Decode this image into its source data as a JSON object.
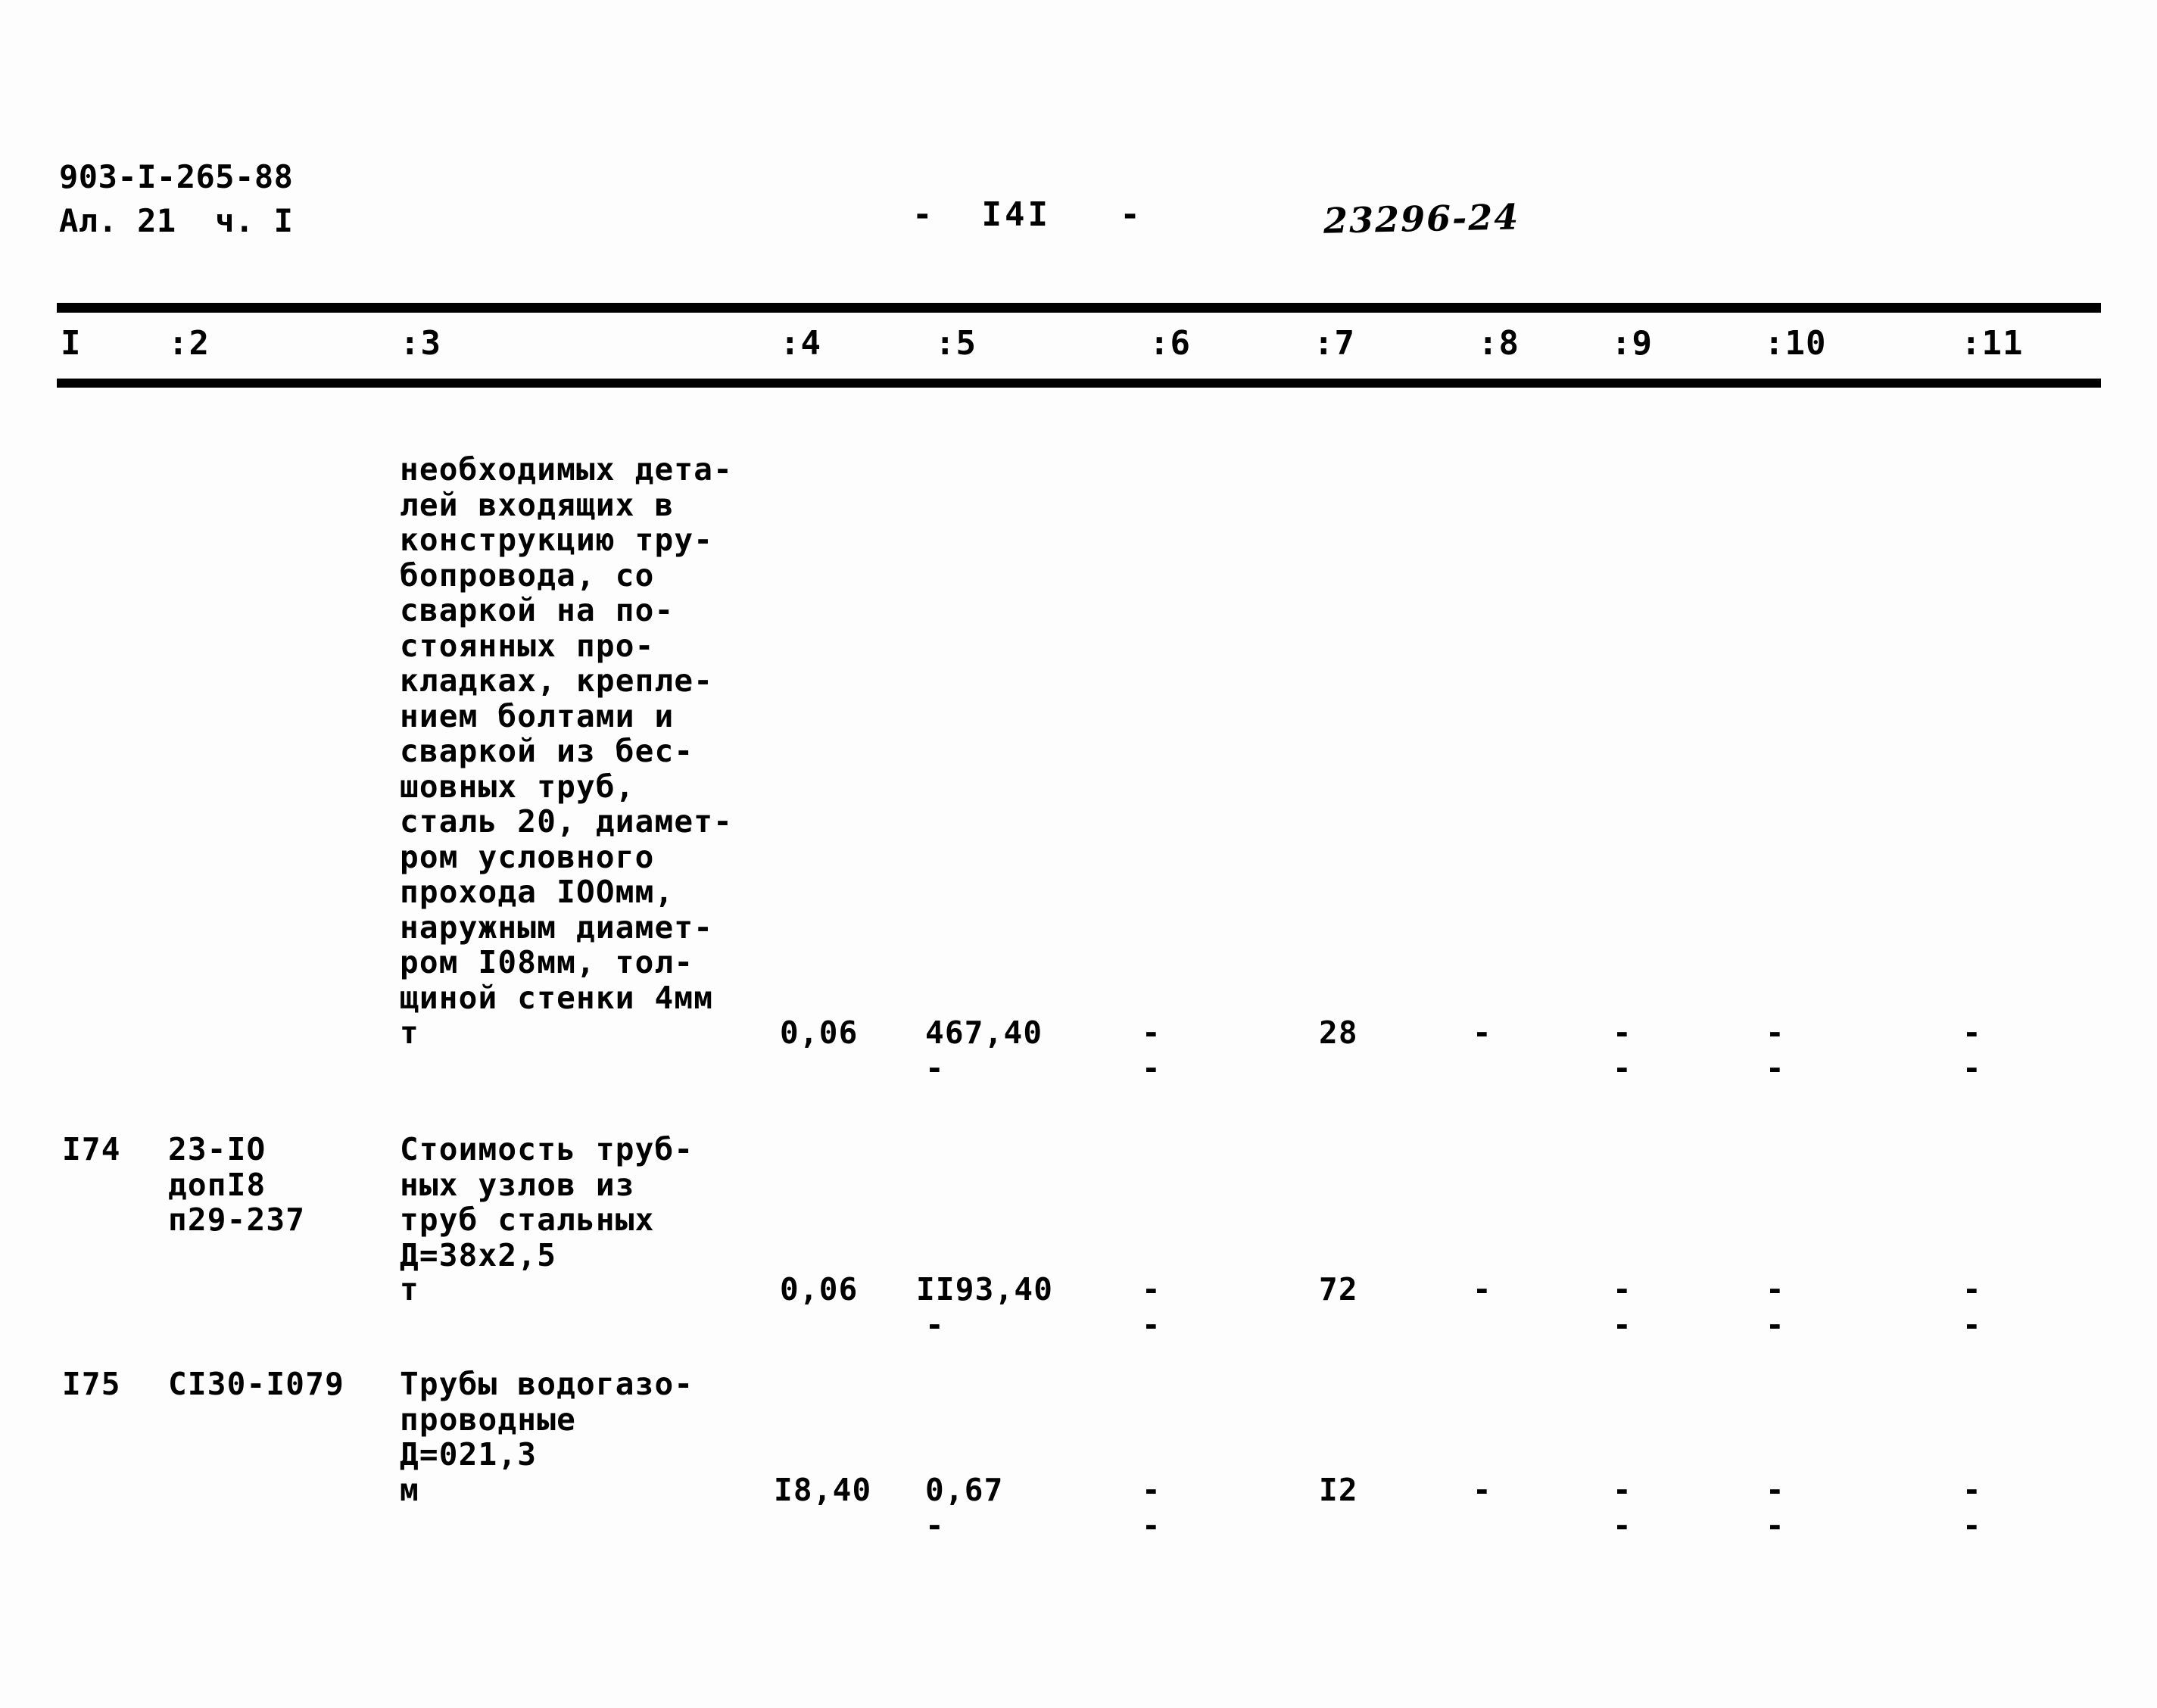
{
  "header": {
    "doc_code": "903-I-265-88",
    "doc_sub": "Ал. 21  ч. I",
    "page_number": "-  I4I   -",
    "archive_stamp": "23296-24"
  },
  "table": {
    "column_headers": [
      "I",
      ":2",
      ":3",
      ":4",
      ":5",
      ":6",
      ":7",
      ":8",
      ":9",
      ":10",
      ":11"
    ],
    "rows": [
      {
        "no": "",
        "code": "",
        "description": "необходимых дета-\nлей входящих в\nконструкцию тру-\nбопровода, со\nсваркой на по-\nстоянных про-\nкладках, крепле-\nнием болтами и\nсваркой из бес-\nшовных труб,\nсталь 20, диамет-\nром условного\nпрохода IOOмм,\nнаружным диамет-\nром I08мм, тол-\nщиной стенки 4мм",
        "unit": "т",
        "c4": "0,06",
        "c5": "467,40",
        "c5b": "-",
        "c6": "-",
        "c6b": "-",
        "c7": "28",
        "c7b": "",
        "c8": "-",
        "c8b": "",
        "c9": "-",
        "c9b": "-",
        "c10": "-",
        "c10b": "-",
        "c11": "-",
        "c11b": "-"
      },
      {
        "no": "I74",
        "code": "23-IO\nдопI8\nп29-237",
        "description": "Стоимость труб-\nных узлов из\nтруб стальных\nД=38х2,5",
        "unit": "т",
        "c4": "0,06",
        "c5": "II93,40",
        "c5b": "-",
        "c6": "-",
        "c6b": "-",
        "c7": "72",
        "c7b": "",
        "c8": "-",
        "c8b": "",
        "c9": "-",
        "c9b": "-",
        "c10": "-",
        "c10b": "-",
        "c11": "-",
        "c11b": "-"
      },
      {
        "no": "I75",
        "code": "CI30-I079",
        "description": "Трубы водогазо-\nпроводные\nД=021,3",
        "unit": "м",
        "c4": "I8,40",
        "c5": "0,67",
        "c5b": "-",
        "c6": "-",
        "c6b": "-",
        "c7": "I2",
        "c7b": "",
        "c8": "-",
        "c8b": "",
        "c9": "-",
        "c9b": "-",
        "c10": "-",
        "c10b": "-",
        "c11": "-",
        "c11b": "-"
      }
    ]
  }
}
